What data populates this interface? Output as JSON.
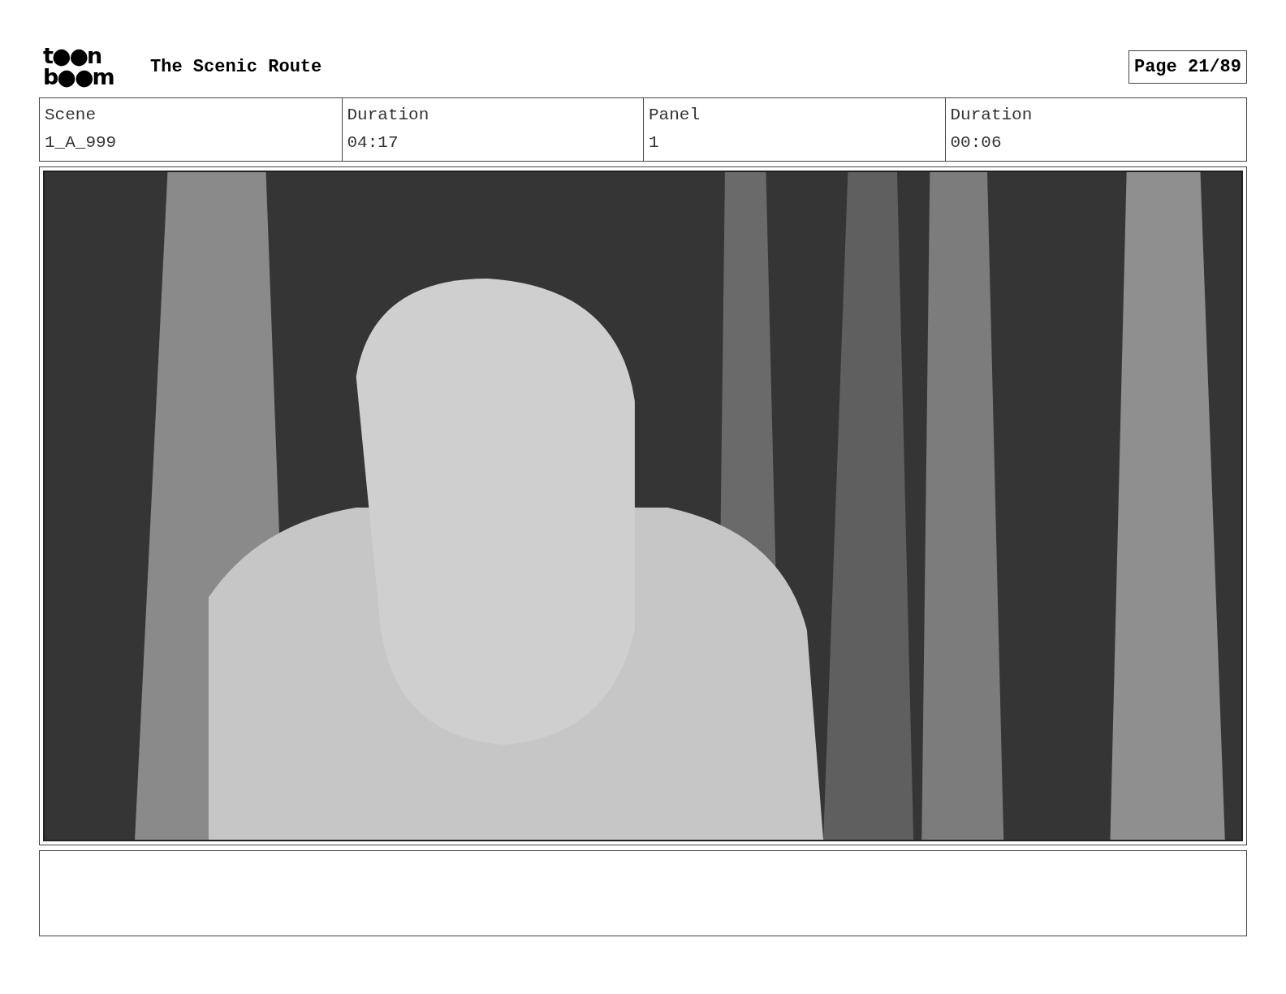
{
  "header": {
    "logo": [
      "t●●n",
      "b●●m"
    ],
    "title": "The Scenic Route",
    "page": "Page 21/89"
  },
  "info": [
    {
      "label": "Scene",
      "value": "1_A_999"
    },
    {
      "label": "Duration",
      "value": "04:17"
    },
    {
      "label": "Panel",
      "value": "1"
    },
    {
      "label": "Duration",
      "value": "00:06"
    }
  ]
}
